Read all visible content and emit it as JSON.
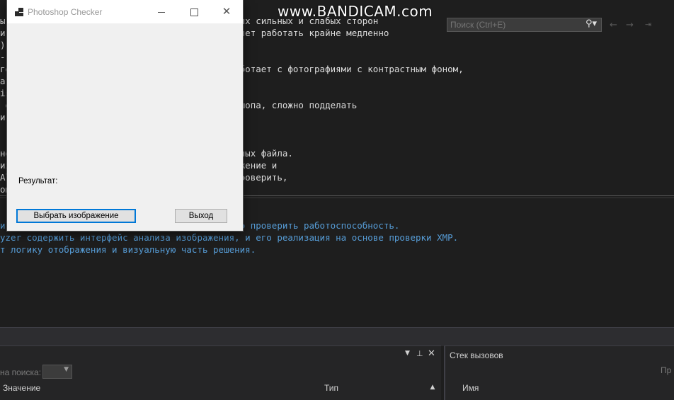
{
  "watermark": {
    "brand": "www.BANDICAM.com"
  },
  "editor": {
    "lines": [
      {
        "text": "ы          ков проверки фотошопа с указанием их сильных и слабых сторон",
        "color": "text"
      },
      {
        "text": "и                                      Позволяет работать крайне медленно",
        "color": "text"
      },
      {
        "text": ")",
        "color": "text"
      },
      {
        "text": "-",
        "color": "text"
      },
      {
        "text": "го                                    , не работает с фотографиями с контрастным фоном,",
        "color": "text"
      },
      {
        "text": "ат",
        "color": "text"
      },
      {
        "text": "is",
        "color": "text"
      },
      {
        "text": " о                                   ния фотошопа, сложно подделать",
        "color": "text"
      },
      {
        "text": "и                                     ача",
        "color": "text"
      },
      {
        "text": "",
        "color": "text"
      },
      {
        "text": "",
        "color": "text"
      },
      {
        "text": "но                                    метаданных файла.",
        "color": "text"
      },
      {
        "text": "из                                   ь изображение и",
        "color": "text"
      },
      {
        "text": "Al                                    тегов проверить,",
        "color": "text"
      },
      {
        "text": "ош",
        "color": "text"
      },
      {
        "text": "-",
        "color": "text"
      }
    ],
    "output_lines": [
      {
        "text": "ит                                   рых можно проверить работоспособность."
      },
      {
        "text": "yzer содержить интерфейс анализа изображения, и его реализация на основе проверки XMP."
      },
      {
        "text": "т логику отображения и визуальную часть решения."
      }
    ]
  },
  "locals_panel": {
    "search_depth_label": "на поиска:",
    "col_value": "Значение",
    "col_type": "Тип"
  },
  "callstack_panel": {
    "title": "Стек вызовов",
    "search_placeholder": "Поиск (Ctrl+E)",
    "col_name": "Имя",
    "truncated_label": "Пр"
  },
  "app_window": {
    "title": "Photoshop Checker",
    "result_label": "Результат:",
    "pick_button": "Выбрать изображение",
    "exit_button": "Выход"
  },
  "icons": {
    "app": "app-icon",
    "minimize": "minimize-icon",
    "maximize": "maximize-icon",
    "close": "close-icon",
    "search": "search-icon",
    "pin": "pin-icon",
    "back": "arrow-left-icon",
    "forward": "arrow-right-icon"
  },
  "colors": {
    "editor_bg": "#1e1e1e",
    "code_text": "#dcdcdc",
    "code_blue": "#569cd6",
    "window_bg": "#f0f0f0",
    "accent": "#0078d7"
  }
}
